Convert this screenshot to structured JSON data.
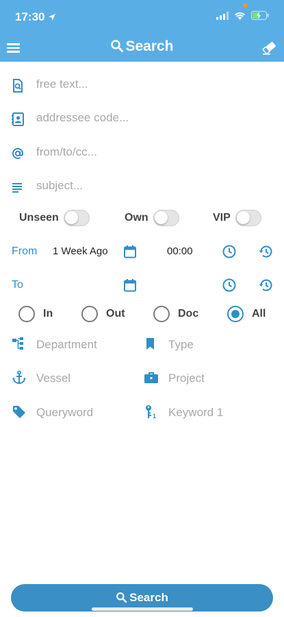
{
  "status_bar": {
    "time": "17:30"
  },
  "header": {
    "title": "Search"
  },
  "fields": {
    "free_text": {
      "placeholder": "free text..."
    },
    "addressee": {
      "placeholder": "addressee code..."
    },
    "from_to_cc": {
      "placeholder": "from/to/cc..."
    },
    "subject": {
      "placeholder": "subject..."
    }
  },
  "toggles": {
    "unseen": {
      "label": "Unseen",
      "on": false
    },
    "own": {
      "label": "Own",
      "on": false
    },
    "vip": {
      "label": "VIP",
      "on": false
    }
  },
  "date_from": {
    "label": "From",
    "value": "1 Week Ago",
    "time": "00:00"
  },
  "date_to": {
    "label": "To",
    "value": "",
    "time": ""
  },
  "direction": {
    "options": [
      "In",
      "Out",
      "Doc",
      "All"
    ],
    "selected": "All"
  },
  "filters": {
    "department": "Department",
    "type": "Type",
    "vessel": "Vessel",
    "project": "Project",
    "queryword": "Queryword",
    "keyword1": "Keyword 1"
  },
  "actions": {
    "search_label": "Search"
  },
  "colors": {
    "header": "#5aaee6",
    "accent": "#2f8ec7",
    "button": "#3a8fc4",
    "placeholder": "#a8a8a8"
  }
}
